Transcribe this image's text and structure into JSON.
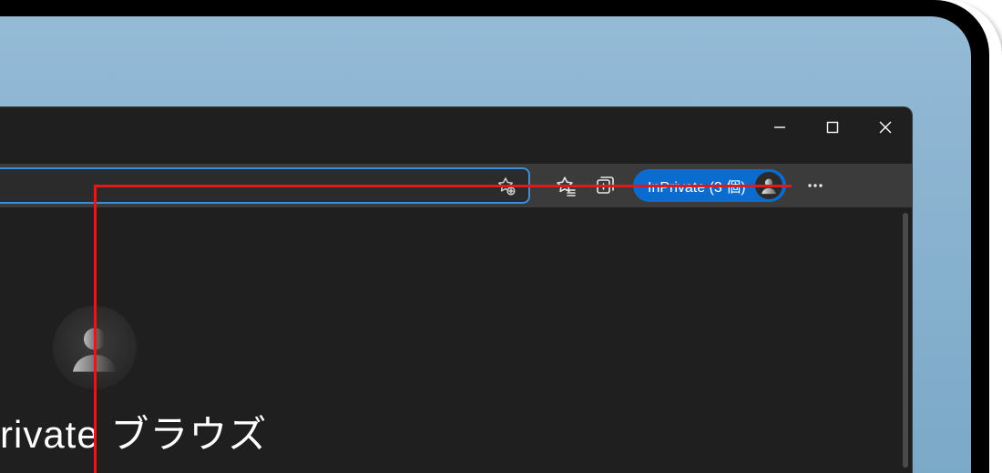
{
  "window": {
    "mode_inprivate_badge": "InPrivate (3 個)"
  },
  "content": {
    "headline": "rivate ブラウズ"
  },
  "icons": {
    "minimize": "minimize-icon",
    "maximize": "maximize-icon",
    "close": "close-icon",
    "add_favorite": "star-plus-icon",
    "favorites": "star-list-icon",
    "collections": "collections-icon",
    "profile": "avatar-icon",
    "more": "more-icon"
  },
  "colors": {
    "accent": "#0a6cce",
    "address_focus": "#3a8fd6",
    "annotation": "#e11919",
    "wallpaper_top": "#94bad6",
    "wallpaper_bottom": "#7ba9c8",
    "browser_bg": "#1f1f1f",
    "toolbar_bg": "#3b3b3b"
  }
}
